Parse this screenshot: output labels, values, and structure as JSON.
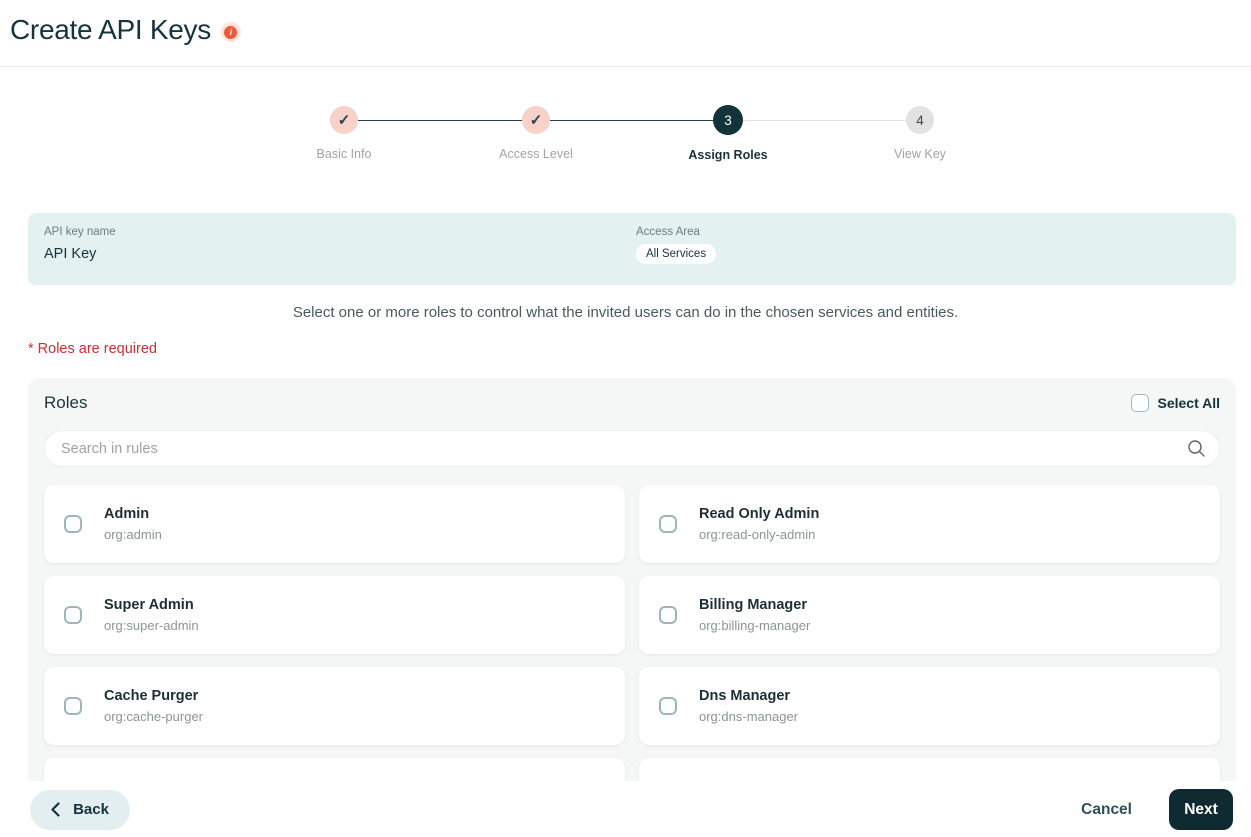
{
  "header": {
    "title": "Create API Keys",
    "info_glyph": "i"
  },
  "stepper": {
    "check_glyph": "✓",
    "steps": [
      {
        "label": "Basic Info",
        "state": "completed"
      },
      {
        "label": "Access Level",
        "state": "completed"
      },
      {
        "label": "Assign Roles",
        "state": "active",
        "number": "3"
      },
      {
        "label": "View Key",
        "state": "upcoming",
        "number": "4"
      }
    ]
  },
  "summary": {
    "api_key_name_label": "API key name",
    "api_key_name_value": "API Key",
    "access_area_label": "Access Area",
    "access_area_chip": "All Services"
  },
  "instruction": "Select one or more roles to control what the invited users can do in the chosen services and entities.",
  "required_note": "* Roles are required",
  "roles_panel": {
    "title": "Roles",
    "select_all_label": "Select All",
    "search_placeholder": "Search in rules",
    "roles": [
      {
        "name": "Admin",
        "id": "org:admin"
      },
      {
        "name": "Read Only Admin",
        "id": "org:read-only-admin"
      },
      {
        "name": "Super Admin",
        "id": "org:super-admin"
      },
      {
        "name": "Billing Manager",
        "id": "org:billing-manager"
      },
      {
        "name": "Cache Purger",
        "id": "org:cache-purger"
      },
      {
        "name": "Dns Manager",
        "id": "org:dns-manager"
      }
    ]
  },
  "footer": {
    "back_label": "Back",
    "cancel_label": "Cancel",
    "next_label": "Next"
  },
  "colors": {
    "accent_dark": "#12333a",
    "step_completed_pink": "#f8d2c9",
    "info_orange": "#f4563a",
    "summary_bg": "#e4f1f1",
    "panel_bg": "#f5f6f6",
    "required_red": "#cf2e2e",
    "next_button_bg": "#0f2b31",
    "back_button_bg": "#e3eef0"
  }
}
